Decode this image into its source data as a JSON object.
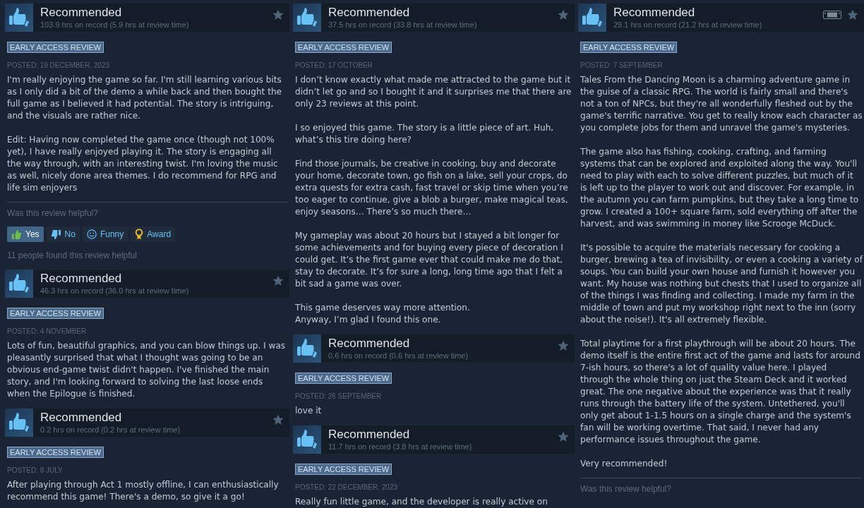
{
  "columns": [
    {
      "reviews": [
        {
          "title": "Recommended",
          "hours": "103.9 hrs on record (5.9 hrs at review time)",
          "deck_icon": false,
          "badge": "EARLY ACCESS REVIEW",
          "posted": "POSTED: 19 DECEMBER, 2023",
          "paragraphs": [
            "I'm really enjoying the game so far. I'm still learning various bits as I only did a bit of the demo a while back and then bought the full game as I believed it had potential. The story is intriguing, and the visuals are rather nice.",
            "Edit: Having now completed the game once (though not 100% yet), I have really enjoyed playing it. The story is engaging all the way through, with an interesting twist. I'm loving the music as well, nicely done area themes. I do recommend for RPG and life sim enjoyers"
          ],
          "helpful": {
            "question": "Was this review helpful?",
            "buttons": [
              {
                "kind": "yes",
                "label": "Yes",
                "selected": true
              },
              {
                "kind": "no",
                "label": "No",
                "selected": false
              },
              {
                "kind": "funny",
                "label": "Funny",
                "selected": false
              },
              {
                "kind": "award",
                "label": "Award",
                "selected": false
              }
            ],
            "count": "11 people found this review helpful"
          }
        },
        {
          "title": "Recommended",
          "hours": "46.3 hrs on record (36.0 hrs at review time)",
          "deck_icon": false,
          "badge": "EARLY ACCESS REVIEW",
          "posted": "POSTED: 4 NOVEMBER",
          "paragraphs": [
            "Lots of fun, beautiful graphics, and you can blow things up. I was pleasantly surprised that what I thought was going to be an obvious end-game twist didn't happen. I've finished the main story, and I'm looking forward to solving the last loose ends when the Epilogue is finished."
          ]
        },
        {
          "title": "Recommended",
          "hours": "0.2 hrs on record (0.2 hrs at review time)",
          "deck_icon": false,
          "badge": "EARLY ACCESS REVIEW",
          "posted": "POSTED: 8 JULY",
          "paragraphs": [
            "After playing through Act 1 mostly offline, I can enthusiastically recommend this game! There's a demo, so give it a go!"
          ]
        }
      ]
    },
    {
      "reviews": [
        {
          "title": "Recommended",
          "hours": "37.5 hrs on record (33.8 hrs at review time)",
          "deck_icon": false,
          "badge": "EARLY ACCESS REVIEW",
          "posted": "POSTED: 17 OCTOBER",
          "paragraphs": [
            "I don’t know exactly what made me attracted to the game but it didn’t let go and so I bought it and it surprises me that there are only 23 reviews at this point.",
            "I so enjoyed this game. The story is a little piece of art. Huh, what’s this tire doing here?",
            "Find those journals, be creative in cooking, buy and decorate your home, decorate town, go fish on a lake, sell your crops, do extra quests for extra cash, fast travel or skip time when you’re too eager to continue, give a blob a burger, make magical teas, enjoy seasons… There’s so much there…",
            "My gameplay was about 20 hours but I stayed a bit longer for some achievements and for buying every piece of decoration I could get. It’s the first game ever that could make me do that, stay to decorate. It’s for sure a long, long time ago that I felt a bit sad a game was over.",
            "This game deserves way more attention.\nAnyway, I’m glad I found this one."
          ]
        },
        {
          "title": "Recommended",
          "hours": "0.6 hrs on record (0.6 hrs at review time)",
          "deck_icon": false,
          "badge": "EARLY ACCESS REVIEW",
          "posted": "POSTED: 26 SEPTEMBER",
          "paragraphs": [
            "love it"
          ]
        },
        {
          "title": "Recommended",
          "hours": "11.7 hrs on record (3.8 hrs at review time)",
          "deck_icon": false,
          "badge": "EARLY ACCESS REVIEW",
          "posted": "POSTED: 22 DECEMBER, 2023",
          "paragraphs": [
            "Really fun little game, and the developer is really active on"
          ]
        }
      ]
    },
    {
      "reviews": [
        {
          "title": "Recommended",
          "hours": "29.1 hrs on record (21.2 hrs at review time)",
          "deck_icon": true,
          "badge": "EARLY ACCESS REVIEW",
          "posted": "POSTED: 7 SEPTEMBER",
          "paragraphs": [
            "Tales From the Dancing Moon is a charming adventure game in the guise of a classic RPG. The world is fairly small and there's not a ton of NPCs, but they're all wonderfully fleshed out by the game's terrific narrative. You get to really know each character as you complete jobs for them and unravel the game's mysteries.",
            "The game also has fishing, cooking, crafting, and farming systems that can be explored and exploited along the way. You'll need to play with each to solve different puzzles, but much of it is left up to the player to work out and discover. For example, in the autumn you can farm pumpkins, but they take a long time to grow. I created a 100+ square farm, sold everything off after the harvest, and was swimming in money like Scrooge McDuck.",
            "It's possible to acquire the materials necessary for cooking a burger, brewing a tea of invisibility, or even a cooking a variety of soups. You can build your own house and furnish it however you want. My house was nothing but chests that I used to organize all of the things I was finding and collecting. I made my farm in the middle of town and put my workshop right next to the inn (sorry about the noise!). It's all extremely flexible.",
            "Total playtime for a first playthrough will be about 20 hours. The demo itself is the entire first act of the game and lasts for around 7-ish hours, so there's a lot of quality value here. I played through the whole thing on just the Steam Deck and it worked great. The one negative about the experience was that it really runs through the battery life of the system. Untethered, you'll only get about 1-1.5 hours on a single charge and the system's fan will be working overtime. That said, I never had any performance issues throughout the game.",
            "Very recommended!"
          ],
          "helpful": {
            "question": "Was this review helpful?"
          }
        }
      ]
    }
  ]
}
